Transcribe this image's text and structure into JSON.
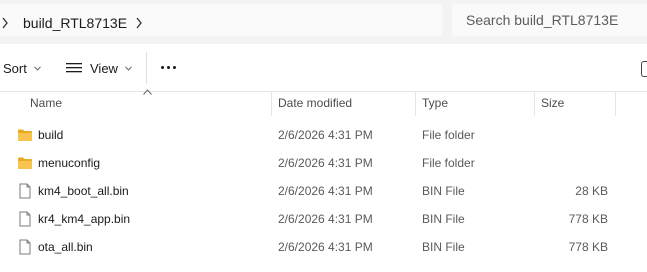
{
  "address": {
    "breadcrumb": [
      "build_RTL8713E"
    ],
    "search_placeholder": "Search build_RTL8713E"
  },
  "toolbar": {
    "sort_label": "Sort",
    "view_label": "View",
    "more_label": "..."
  },
  "columns": {
    "name": "Name",
    "date": "Date modified",
    "type": "Type",
    "size": "Size"
  },
  "files": [
    {
      "name": "build",
      "date": "2/6/2026 4:31 PM",
      "type": "File folder",
      "size": "",
      "icon": "folder-icon"
    },
    {
      "name": "menuconfig",
      "date": "2/6/2026 4:31 PM",
      "type": "File folder",
      "size": "",
      "icon": "folder-icon"
    },
    {
      "name": "km4_boot_all.bin",
      "date": "2/6/2026 4:31 PM",
      "type": "BIN File",
      "size": "28 KB",
      "icon": "file-icon"
    },
    {
      "name": "kr4_km4_app.bin",
      "date": "2/6/2026 4:31 PM",
      "type": "BIN File",
      "size": "778 KB",
      "icon": "file-icon"
    },
    {
      "name": "ota_all.bin",
      "date": "2/6/2026 4:31 PM",
      "type": "BIN File",
      "size": "778 KB",
      "icon": "file-icon"
    }
  ],
  "colors": {
    "folder": "#f8c44f",
    "folder_dark": "#e9ab26",
    "address_bg": "#f3f3f3"
  }
}
